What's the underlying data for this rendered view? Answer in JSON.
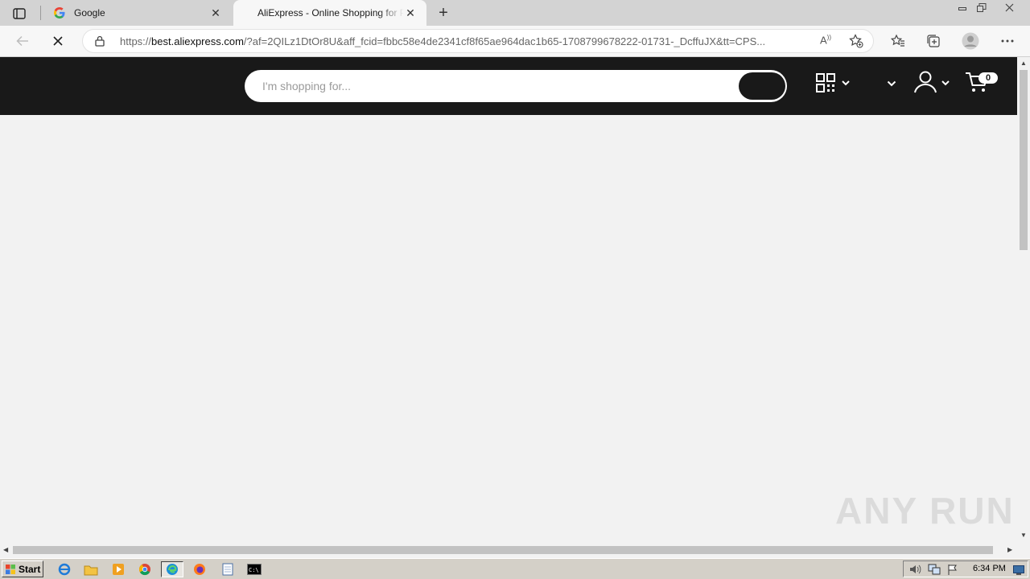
{
  "browser": {
    "tabs": [
      {
        "title": "Google",
        "favicon": "google-g-icon",
        "active": false
      },
      {
        "title": "AliExpress - Online Shopping for Popular Electronics",
        "favicon": "loading-icon",
        "active": true
      }
    ],
    "address": {
      "url_prefix": "https://",
      "url_host": "best.aliexpress.com",
      "url_rest": "/?af=2QILz1DtOr8U&aff_fcid=fbbc58e4de2341cf8f65ae964dac1b65-1708799678222-01731-_DcffuJX&tt=CPS..."
    }
  },
  "site": {
    "search_placeholder": "I'm shopping for...",
    "cart_count": "0"
  },
  "watermark": "ANY RUN",
  "taskbar": {
    "start_label": "Start",
    "clock": "6:34 PM"
  },
  "colors": {
    "header_bg": "#191919",
    "page_bg": "#f2f2f2",
    "tabstrip_bg": "#d3d3d3",
    "taskbar_bg": "#d4d0c8"
  }
}
